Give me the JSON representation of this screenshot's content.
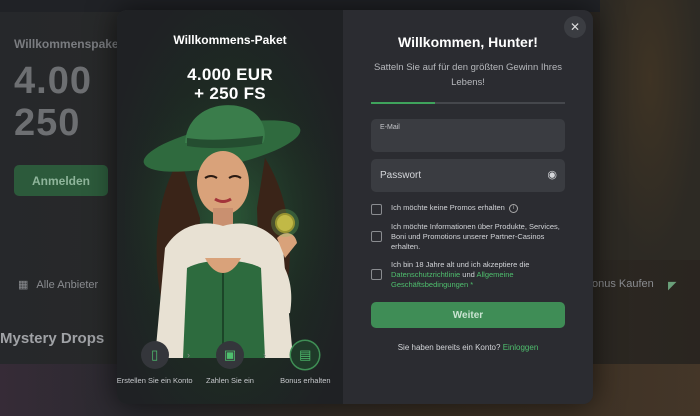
{
  "background": {
    "promo_title": "Willkommenspaket",
    "big_line1": "4.00",
    "big_line2": "250",
    "login_button": "Anmelden",
    "providers_label": "Alle Anbieter",
    "bonus_buy_label": "onus Kaufen",
    "section_title": "Mystery Drops"
  },
  "promo": {
    "title": "Willkommens-Paket",
    "amount_line1": "4.000 EUR",
    "amount_line2": "+ 250 FS",
    "steps": [
      {
        "label": "Erstellen Sie ein Konto",
        "icon": "phone-icon"
      },
      {
        "label": "Zahlen Sie ein",
        "icon": "wallet-icon"
      },
      {
        "label": "Bonus erhalten",
        "icon": "gift-icon"
      }
    ]
  },
  "form": {
    "title": "Willkommen, Hunter!",
    "subtitle": "Satteln Sie auf für den größten Gewinn Ihres Lebens!",
    "progress": 0.33,
    "email_label": "E-Mail",
    "password_label": "Passwort",
    "check_no_promos": "Ich möchte keine Promos erhalten",
    "check_partner_info": "Ich möchte Informationen über Produkte, Services, Boni und Promotions unserer Partner-Casinos erhalten.",
    "check_age_prefix": "Ich bin 18 Jahre alt und ich akzeptiere die",
    "check_age_privacy": "Datenschutzrichtlinie",
    "check_age_and": "und",
    "check_age_terms": "Allgemeine Geschäftsbedingungen",
    "check_age_required": "*",
    "submit_label": "Weiter",
    "login_prompt": "Sie haben bereits ein Konto?",
    "login_link": "Einloggen"
  },
  "colors": {
    "accent": "#3f8d56",
    "link": "#4fbf6e",
    "modal_bg": "#2b2c31"
  }
}
